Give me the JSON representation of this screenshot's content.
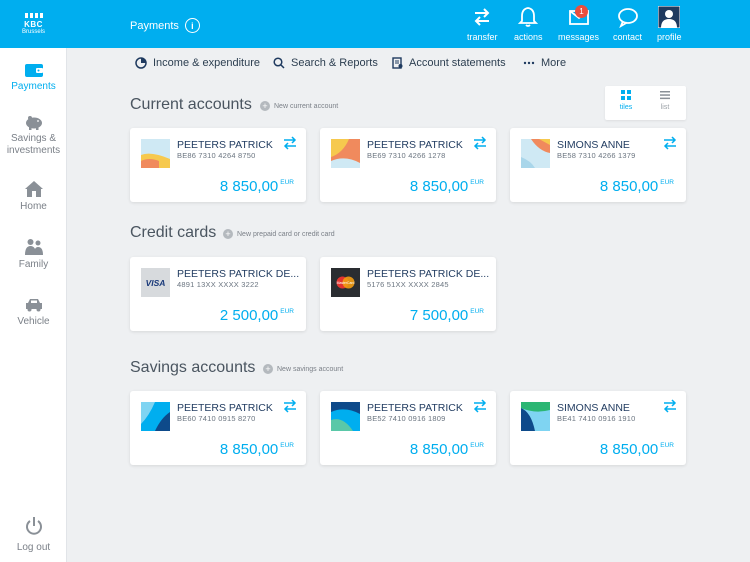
{
  "brand": {
    "name": "KBC",
    "city": "Brussels"
  },
  "sidebar": {
    "items": [
      {
        "label": "Payments",
        "icon": "wallet-icon"
      },
      {
        "label": "Savings & investments",
        "icon": "piggy-bank-icon"
      },
      {
        "label": "Home",
        "icon": "house-icon"
      },
      {
        "label": "Family",
        "icon": "family-icon"
      },
      {
        "label": "Vehicle",
        "icon": "car-icon"
      }
    ],
    "logout": "Log out"
  },
  "header": {
    "title": "Payments",
    "info": "i",
    "actions": [
      {
        "label": "transfer",
        "icon": "transfer-icon"
      },
      {
        "label": "actions",
        "icon": "bell-icon"
      },
      {
        "label": "messages",
        "icon": "envelope-icon",
        "badge": "1"
      },
      {
        "label": "contact",
        "icon": "chat-icon"
      },
      {
        "label": "profile",
        "icon": "user-icon"
      }
    ]
  },
  "subnav": [
    {
      "label": "Income & expenditure",
      "icon": "pie-chart-icon"
    },
    {
      "label": "Search & Reports",
      "icon": "search-icon"
    },
    {
      "label": "Account statements",
      "icon": "statement-icon"
    },
    {
      "label": "More",
      "icon": "more-icon"
    }
  ],
  "view_toggle": {
    "tiles": "tiles",
    "list": "list",
    "selected": "tiles"
  },
  "sections": {
    "current": {
      "title": "Current accounts",
      "new_link": "New current account",
      "cards": [
        {
          "name": "PEETERS PATRICK",
          "iban": "BE86 7310 4264 8750",
          "amount": "8 850,00",
          "currency": "EUR"
        },
        {
          "name": "PEETERS PATRICK",
          "iban": "BE69 7310 4266 1278",
          "amount": "8 850,00",
          "currency": "EUR"
        },
        {
          "name": "SIMONS ANNE",
          "iban": "BE58 7310 4266 1379",
          "amount": "8 850,00",
          "currency": "EUR"
        }
      ]
    },
    "credit": {
      "title": "Credit cards",
      "new_link": "New prepaid card or credit card",
      "cards": [
        {
          "name": "PEETERS PATRICK DE...",
          "iban": "4891 13XX XXXX 3222",
          "amount": "2 500,00",
          "currency": "EUR",
          "brand": "VISA"
        },
        {
          "name": "PEETERS PATRICK DE...",
          "iban": "5176 51XX XXXX 2845",
          "amount": "7 500,00",
          "currency": "EUR",
          "brand": "MasterCard"
        }
      ]
    },
    "savings": {
      "title": "Savings accounts",
      "new_link": "New savings account",
      "cards": [
        {
          "name": "PEETERS PATRICK",
          "iban": "BE60 7410 0915 8270",
          "amount": "8 850,00",
          "currency": "EUR"
        },
        {
          "name": "PEETERS PATRICK",
          "iban": "BE52 7410 0916 1809",
          "amount": "8 850,00",
          "currency": "EUR"
        },
        {
          "name": "SIMONS ANNE",
          "iban": "BE41 7410 0916 1910",
          "amount": "8 850,00",
          "currency": "EUR"
        }
      ]
    }
  },
  "colors": {
    "accent": "#00aeef",
    "navy": "#1f3a5f",
    "badge": "#e94e3d"
  }
}
